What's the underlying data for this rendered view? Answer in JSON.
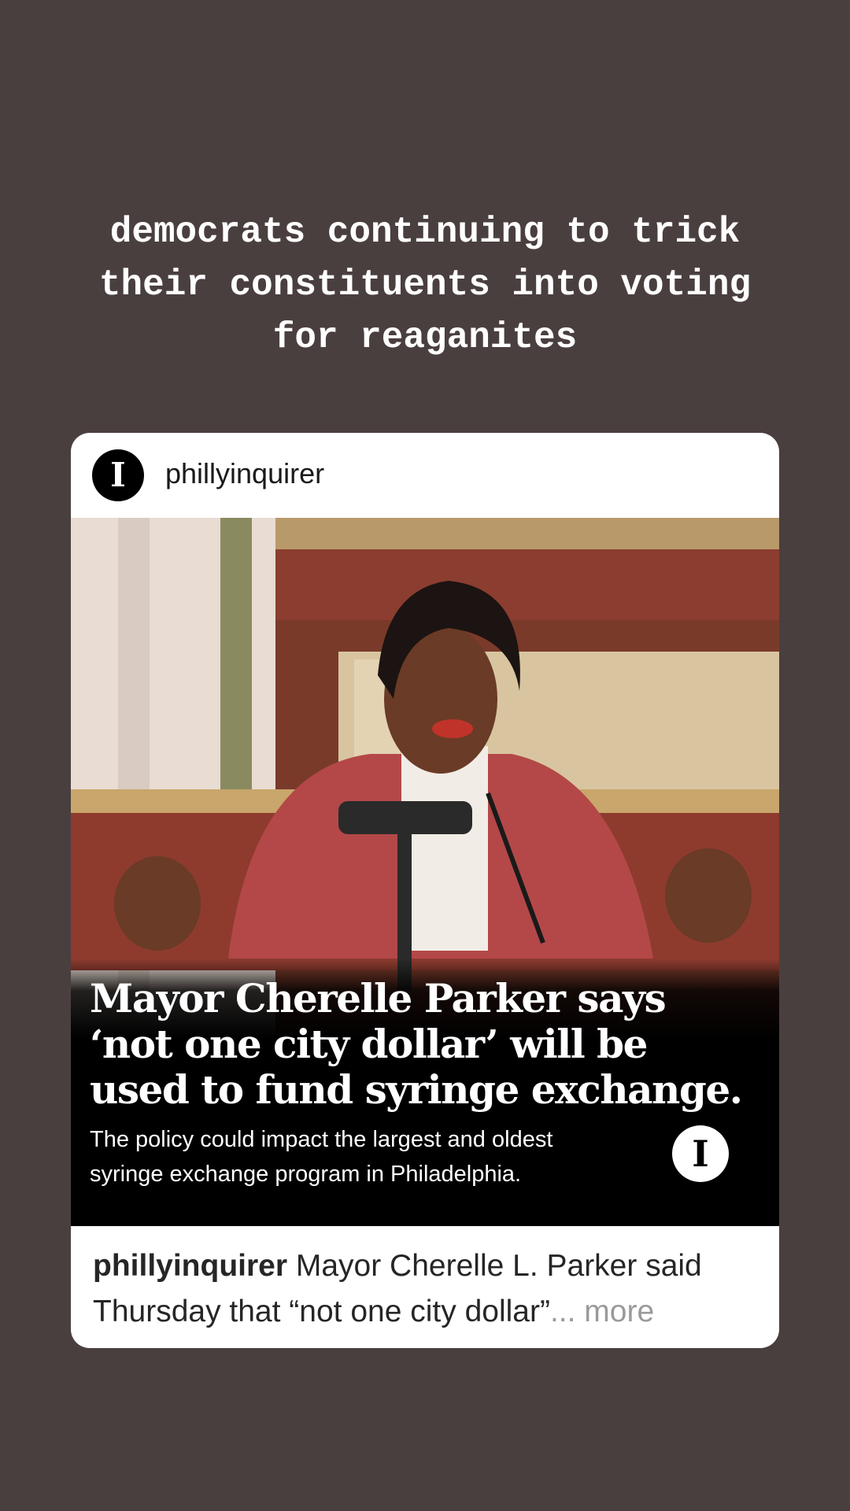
{
  "story": {
    "caption_lines": [
      "democrats continuing to trick",
      "their constituents into voting",
      "for reaganites"
    ]
  },
  "post": {
    "avatar_glyph": "I",
    "username": "phillyinquirer",
    "image": {
      "headline_lines": [
        "Mayor Cherelle Parker says",
        "‘not one city dollar’ will be",
        "used to fund syringe exchange."
      ],
      "subhead_lines": [
        "The policy could impact the largest and oldest",
        "syringe exchange program in Philadelphia."
      ],
      "logo_glyph": "I"
    },
    "caption": {
      "username": "phillyinquirer",
      "line1_text": " Mayor Cherelle L. Parker said",
      "line2_text": "Thursday that “not one city dollar”",
      "ellipsis": "...",
      "more_label": " more"
    }
  },
  "colors": {
    "background": "#4a3f3f",
    "card": "#ffffff",
    "more_link": "#9a9a9a"
  },
  "icons": [
    "inquirer-logo-icon"
  ]
}
